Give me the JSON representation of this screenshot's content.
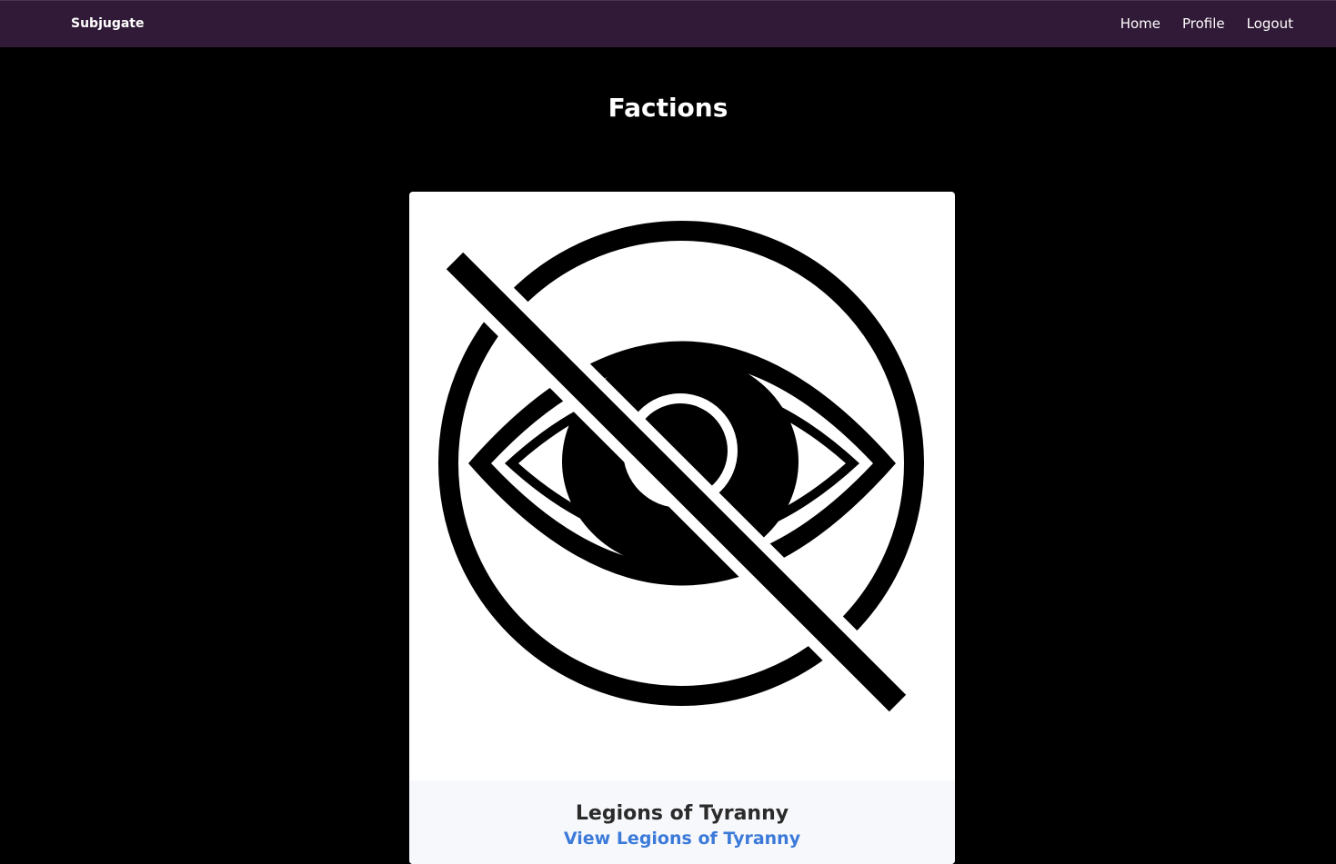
{
  "navbar": {
    "brand": "Subjugate",
    "links": [
      "Home",
      "Profile",
      "Logout"
    ]
  },
  "page": {
    "title": "Factions"
  },
  "factions": [
    {
      "name": "Legions of Tyranny",
      "link_label": "View Legions of Tyranny",
      "icon": "crossed-eye-icon"
    }
  ],
  "colors": {
    "navbar_bg": "#311a37",
    "page_bg": "#000000",
    "card_bg": "#ffffff",
    "card_footer_bg": "#f7f8fc",
    "link": "#3b7ad9"
  }
}
